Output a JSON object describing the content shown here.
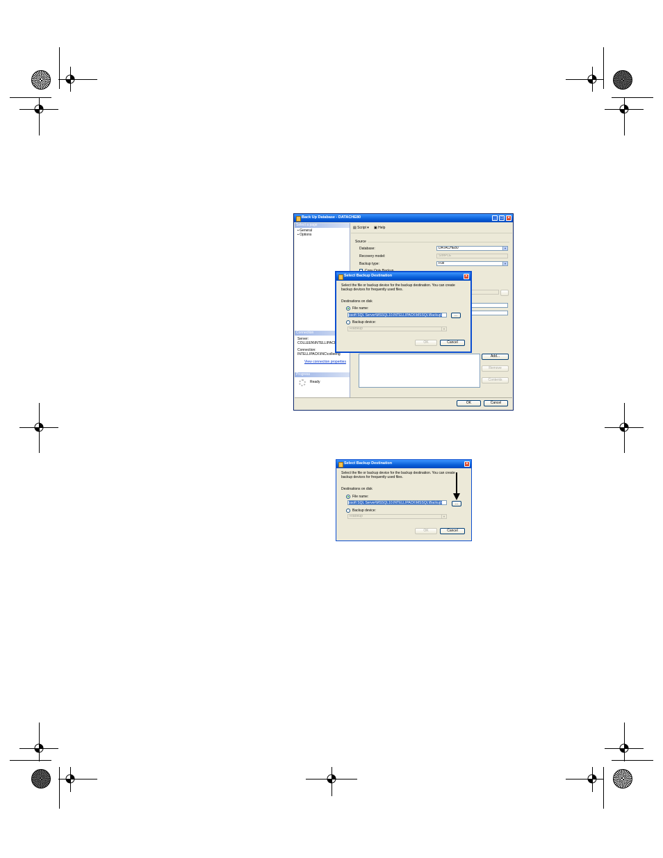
{
  "main_window": {
    "title": "Back Up Database - DATACHE80",
    "select_page_header": "Select a page",
    "pages": [
      "General",
      "Options"
    ],
    "toolbar": {
      "script": "Script",
      "help": "Help"
    },
    "source_label": "Source",
    "database_label": "Database:",
    "database_value": "DATACHE80",
    "recovery_label": "Recovery model:",
    "recovery_value": "SIMPLE",
    "backup_type_label": "Backup type:",
    "backup_type_value": "Full",
    "copy_only_label": "Copy Only Backup",
    "connection_header": "Connection",
    "server_label": "Server:",
    "server_value": "COLLEEN\\INTELLIPACK",
    "connection_label": "Connection:",
    "connection_value": "INTELLIPACK\\INC\\colleeng",
    "view_connection_link": "View connection properties",
    "progress_header": "Progress",
    "progress_status": "Ready",
    "add_button": "Add...",
    "remove_button": "Remove",
    "contents_button": "Contents",
    "ok_button": "OK",
    "cancel_button": "Cancel"
  },
  "dialog": {
    "title": "Select Backup Destination",
    "description": "Select the file or backup device for the backup destination. You can create backup devices for frequently used files.",
    "destinations_label": "Destinations on disk",
    "file_name_label": "File name:",
    "file_name_value": "osoft SQL Server\\MSSQL10.INTELLIPACK\\MSSQL\\Backup\\",
    "browse_button": "...",
    "backup_device_label": "Backup device:",
    "backup_device_value": "RiaBkup",
    "ok_button": "OK",
    "cancel_button": "Cancel"
  },
  "colors": {
    "title_gradient_top": "#3d95ff",
    "title_gradient_bottom": "#0048c0",
    "window_face": "#ece9d8",
    "selection": "#316ac5",
    "close_button": "#d9482b"
  }
}
